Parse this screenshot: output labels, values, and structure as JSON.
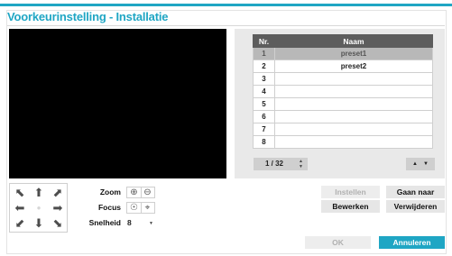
{
  "dialog": {
    "title": "Voorkeurinstelling - Installatie"
  },
  "presets": {
    "headers": {
      "nr": "Nr.",
      "naam": "Naam"
    },
    "rows": [
      {
        "nr": "1",
        "naam": "preset1",
        "selected": true
      },
      {
        "nr": "2",
        "naam": "preset2",
        "selected": false
      },
      {
        "nr": "3",
        "naam": "",
        "selected": false
      },
      {
        "nr": "4",
        "naam": "",
        "selected": false
      },
      {
        "nr": "5",
        "naam": "",
        "selected": false
      },
      {
        "nr": "6",
        "naam": "",
        "selected": false
      },
      {
        "nr": "7",
        "naam": "",
        "selected": false
      },
      {
        "nr": "8",
        "naam": "",
        "selected": false
      }
    ],
    "page": "1 / 32"
  },
  "controls": {
    "zoom_label": "Zoom",
    "focus_label": "Focus",
    "speed_label": "Snelheid",
    "speed_value": "8"
  },
  "actions": {
    "instellen": "Instellen",
    "gaan_naar": "Gaan naar",
    "bewerken": "Bewerken",
    "verwijderen": "Verwijderen",
    "ok": "OK",
    "annuleren": "Annuleren"
  },
  "icons": {
    "ptz": [
      "arrow-up-left-icon",
      "arrow-up-icon",
      "arrow-up-right-icon",
      "arrow-left-icon",
      "center-dot-icon",
      "arrow-right-icon",
      "arrow-down-left-icon",
      "arrow-down-icon",
      "arrow-down-right-icon"
    ],
    "zoom": [
      "zoom-in-icon",
      "zoom-out-icon"
    ],
    "focus": [
      "focus-near-icon",
      "focus-far-icon"
    ]
  },
  "colors": {
    "accent": "#1fa6c4",
    "header_bg": "#5d5d5d",
    "selected_row": "#b8b8b8",
    "panel_bg": "#e9e9e9"
  }
}
